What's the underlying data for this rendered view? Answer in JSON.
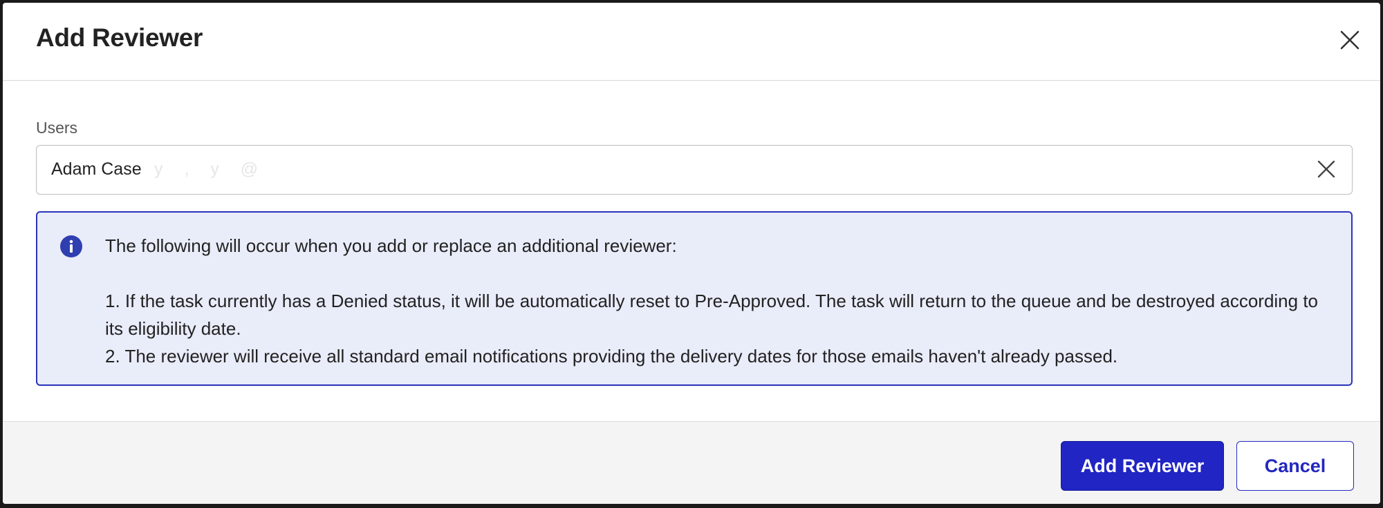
{
  "dialog": {
    "title": "Add Reviewer",
    "close_icon": "close-icon"
  },
  "users_field": {
    "label": "Users",
    "value": "Adam Case",
    "faint_suffix": "y , y @",
    "clear_icon": "clear-x-icon"
  },
  "info": {
    "icon": "info-icon",
    "intro": "The following will occur when you add or replace an additional reviewer:",
    "items": [
      "1. If the task currently has a Denied status, it will be automatically reset to Pre-Approved. The task will return to the queue and be destroyed according to its eligibility date.",
      "2. The reviewer will receive all standard email notifications providing the delivery dates for those emails haven't already passed."
    ]
  },
  "footer": {
    "primary_label": "Add Reviewer",
    "secondary_label": "Cancel"
  },
  "colors": {
    "accent": "#2125c4",
    "info_bg": "#e9ecf9",
    "info_border": "#2a35b8"
  }
}
